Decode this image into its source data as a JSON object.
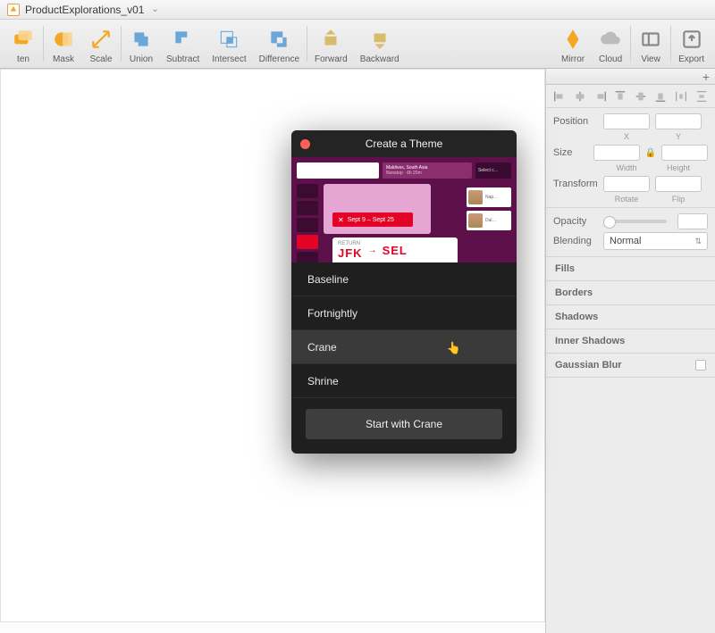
{
  "window": {
    "title": "ProductExplorations_v01"
  },
  "toolbar": {
    "flatten": "ten",
    "mask": "Mask",
    "scale": "Scale",
    "union": "Union",
    "subtract": "Subtract",
    "intersect": "Intersect",
    "difference": "Difference",
    "forward": "Forward",
    "backward": "Backward",
    "mirror": "Mirror",
    "cloud": "Cloud",
    "view": "View",
    "export": "Export"
  },
  "inspector": {
    "position": "Position",
    "x": "X",
    "y": "Y",
    "size": "Size",
    "width": "Width",
    "height": "Height",
    "transform": "Transform",
    "rotate": "Rotate",
    "flip": "Flip",
    "opacity": "Opacity",
    "blending": "Blending",
    "blending_value": "Normal",
    "fills": "Fills",
    "borders": "Borders",
    "shadows": "Shadows",
    "inner_shadows": "Inner Shadows",
    "gaussian_blur": "Gaussian Blur"
  },
  "modal": {
    "title": "Create a Theme",
    "preview": {
      "chip2_l1": "Maldives, South Asia",
      "chip2_l2": "Nonstop · 6h 20m",
      "chip3": "Select c…",
      "pill_dates": "Sept 9 – Sept 25",
      "card_label": "RETURN",
      "jfk": "JFK",
      "sel": "SEL",
      "side1": "Nap…",
      "side2": "Dal…"
    },
    "themes": [
      {
        "label": "Baseline"
      },
      {
        "label": "Fortnightly"
      },
      {
        "label": "Crane"
      },
      {
        "label": "Shrine"
      }
    ],
    "start_label": "Start with Crane"
  }
}
